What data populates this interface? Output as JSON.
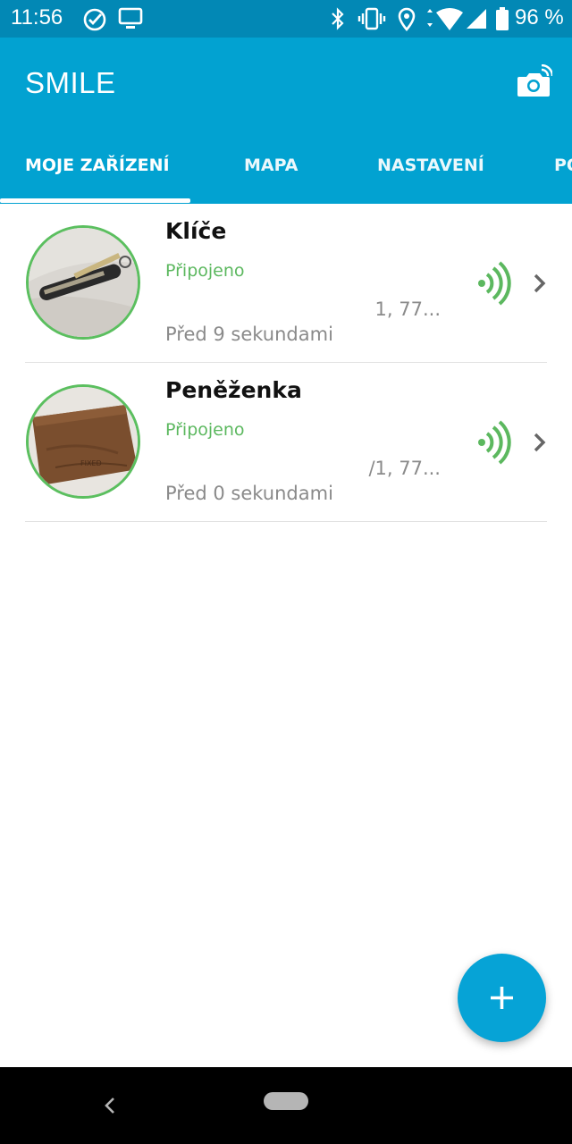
{
  "status_bar": {
    "time": "11:56",
    "battery": "96 %",
    "icons": [
      "check-circle-icon",
      "cast-icon",
      "bluetooth-icon",
      "vibrate-icon",
      "location-icon",
      "wifi-icon",
      "cell-signal-icon",
      "battery-icon"
    ]
  },
  "app_bar": {
    "title": "SMILE",
    "action_icon": "camera-switch-icon"
  },
  "tabs": [
    {
      "label": "MOJE ZAŘÍZENÍ",
      "selected": true
    },
    {
      "label": "MAPA",
      "selected": false
    },
    {
      "label": "NASTAVENÍ",
      "selected": false
    },
    {
      "label": "PO",
      "selected": false
    }
  ],
  "devices": [
    {
      "name": "Klíče",
      "status": "Připojeno",
      "coords": "1, 77...",
      "time_ago": "Před 9 sekundami",
      "avatar": "keys-photo",
      "signal_icon": "signal-strength-icon"
    },
    {
      "name": "Peněženka",
      "status": "Připojeno",
      "coords": "/1, 77...",
      "time_ago": "Před 0 sekundami",
      "avatar": "wallet-photo",
      "signal_icon": "signal-strength-icon"
    }
  ],
  "fab": {
    "icon": "plus-icon"
  },
  "colors": {
    "status_bar": "#0288b5",
    "app_bar": "#02a2d1",
    "accent_green": "#5cb85f",
    "fab": "#06a3d6"
  }
}
